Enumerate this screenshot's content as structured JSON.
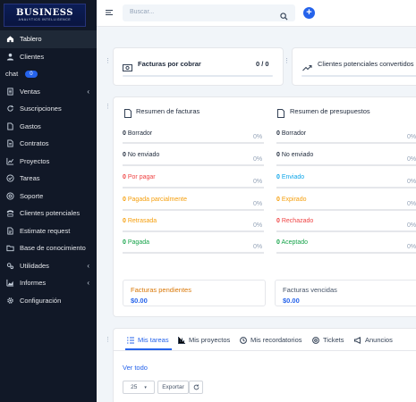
{
  "app": {
    "logo_text": "BUSINESS",
    "logo_tagline": "ANALYTICS INTELLIGENCE"
  },
  "sidebar": {
    "items": [
      {
        "label": "Tablero",
        "icon": "home-icon"
      },
      {
        "label": "Clientes",
        "icon": "user-icon"
      },
      {
        "label": "chat",
        "badge": "0"
      },
      {
        "label": "Ventas",
        "icon": "receipt-icon",
        "chevron": "‹"
      },
      {
        "label": "Suscripciones",
        "icon": "refresh-icon"
      },
      {
        "label": "Gastos",
        "icon": "file-icon"
      },
      {
        "label": "Contratos",
        "icon": "document-icon"
      },
      {
        "label": "Proyectos",
        "icon": "chart-icon"
      },
      {
        "label": "Tareas",
        "icon": "check-circle-icon"
      },
      {
        "label": "Soporte",
        "icon": "support-icon"
      },
      {
        "label": "Clientes potenciales",
        "icon": "tty-icon"
      },
      {
        "label": "Estimate request",
        "icon": "file-alt-icon"
      },
      {
        "label": "Base de conocimiento",
        "icon": "folder-icon"
      },
      {
        "label": "Utilidades",
        "icon": "gears-icon",
        "chevron": "‹"
      },
      {
        "label": "Informes",
        "icon": "chart-area-icon",
        "chevron": "‹"
      },
      {
        "label": "Configuración",
        "icon": "gear-icon"
      }
    ]
  },
  "topbar": {
    "search_placeholder": "Buscar...",
    "add_label": "+"
  },
  "kpis": {
    "invoices_title": "Facturas por cobrar",
    "invoices_value": "0 / 0",
    "leads_title": "Clientes potenciales convertidos"
  },
  "invoice_summary": {
    "title": "Resumen de facturas",
    "rows": [
      {
        "count": "0",
        "label": "Borrador",
        "pct": "0%",
        "color": "#475569"
      },
      {
        "count": "0",
        "label": "No enviado",
        "pct": "0%",
        "color": "#475569"
      },
      {
        "count": "0",
        "label": "Por pagar",
        "pct": "0%",
        "color": "#ef4444"
      },
      {
        "count": "0",
        "label": "Pagada parcialmente",
        "pct": "0%",
        "color": "#f59e0b"
      },
      {
        "count": "0",
        "label": "Retrasada",
        "pct": "0%",
        "color": "#f59e0b"
      },
      {
        "count": "0",
        "label": "Pagada",
        "pct": "0%",
        "color": "#16a34a"
      }
    ]
  },
  "estimate_summary": {
    "title": "Resumen de presupuestos",
    "rows": [
      {
        "count": "0",
        "label": "Borrador",
        "pct": "0%",
        "color": "#475569"
      },
      {
        "count": "0",
        "label": "No enviado",
        "pct": "0%",
        "color": "#475569"
      },
      {
        "count": "0",
        "label": "Enviado",
        "pct": "0%",
        "color": "#0ea5e9"
      },
      {
        "count": "0",
        "label": "Expirado",
        "pct": "0%",
        "color": "#f59e0b"
      },
      {
        "count": "0",
        "label": "Rechazado",
        "pct": "0%",
        "color": "#ef4444"
      },
      {
        "count": "0",
        "label": "Aceptado",
        "pct": "0%",
        "color": "#16a34a"
      }
    ]
  },
  "totals": {
    "pending_label": "Facturas pendientes",
    "pending_value": "$0.00",
    "overdue_label": "Facturas vencidas",
    "overdue_value": "$0.00"
  },
  "tabs": [
    "Mis tareas",
    "Mis proyectos",
    "Mis recordatorios",
    "Tickets",
    "Anuncios"
  ],
  "tasks": {
    "view_all": "Ver todo",
    "page_size": "25",
    "export_label": "Exportar"
  },
  "colors": {
    "accent": "#2563eb",
    "sidebar_bg": "#111827"
  }
}
